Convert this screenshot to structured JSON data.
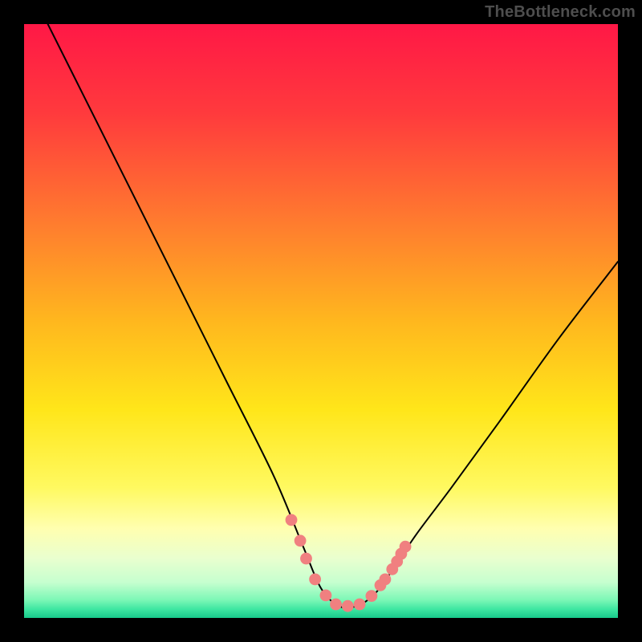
{
  "attribution": "TheBottleneck.com",
  "chart_data": {
    "type": "line",
    "title": "",
    "xlabel": "",
    "ylabel": "",
    "xlim": [
      0,
      100
    ],
    "ylim": [
      0,
      100
    ],
    "background_gradient_stops": [
      {
        "offset": 0.0,
        "color": "#ff1846"
      },
      {
        "offset": 0.15,
        "color": "#ff3a3d"
      },
      {
        "offset": 0.33,
        "color": "#ff7a2f"
      },
      {
        "offset": 0.5,
        "color": "#ffb71e"
      },
      {
        "offset": 0.65,
        "color": "#ffe61a"
      },
      {
        "offset": 0.78,
        "color": "#fff960"
      },
      {
        "offset": 0.85,
        "color": "#ffffb0"
      },
      {
        "offset": 0.9,
        "color": "#e9ffcf"
      },
      {
        "offset": 0.94,
        "color": "#c6ffcf"
      },
      {
        "offset": 0.97,
        "color": "#7bf7b6"
      },
      {
        "offset": 0.985,
        "color": "#3fe7a2"
      },
      {
        "offset": 1.0,
        "color": "#18c98b"
      }
    ],
    "series": [
      {
        "name": "bottleneck-curve",
        "stroke": "#000000",
        "stroke_width": 2,
        "x": [
          4,
          10,
          18,
          26,
          34,
          42,
          47,
          50,
          53,
          56,
          59,
          62,
          66,
          72,
          80,
          90,
          100
        ],
        "values": [
          100,
          88,
          72,
          56,
          40,
          24,
          12,
          5,
          2,
          2,
          4,
          8,
          14,
          22,
          33,
          47,
          60
        ]
      }
    ],
    "markers": {
      "name": "highlighted-points",
      "fill": "#f08080",
      "radius_pct": 1.0,
      "points": [
        {
          "x": 45.0,
          "y": 16.5
        },
        {
          "x": 46.5,
          "y": 13.0
        },
        {
          "x": 47.5,
          "y": 10.0
        },
        {
          "x": 49.0,
          "y": 6.5
        },
        {
          "x": 50.8,
          "y": 3.8
        },
        {
          "x": 52.5,
          "y": 2.3
        },
        {
          "x": 54.5,
          "y": 2.0
        },
        {
          "x": 56.5,
          "y": 2.3
        },
        {
          "x": 58.5,
          "y": 3.7
        },
        {
          "x": 60.0,
          "y": 5.5
        },
        {
          "x": 60.8,
          "y": 6.5
        },
        {
          "x": 62.0,
          "y": 8.2
        },
        {
          "x": 62.8,
          "y": 9.5
        },
        {
          "x": 63.5,
          "y": 10.8
        },
        {
          "x": 64.2,
          "y": 12.0
        }
      ]
    }
  }
}
